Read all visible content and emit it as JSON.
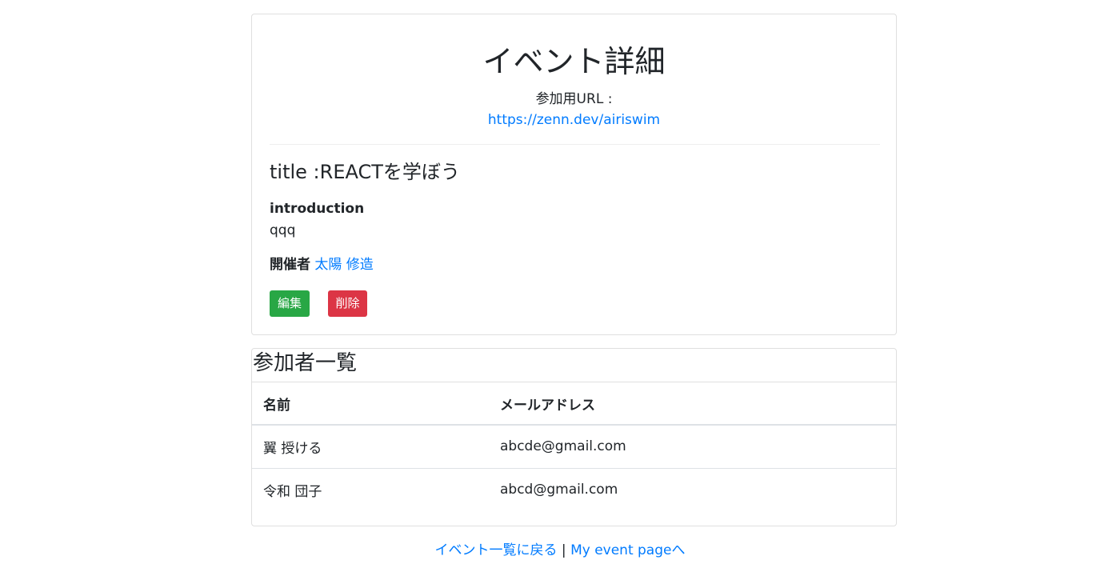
{
  "event": {
    "heading": "イベント詳細",
    "url_label": "参加用URL :",
    "url": "https://zenn.dev/airiswim",
    "title_text": "title :REACTを学ぼう",
    "introduction_label": "introduction",
    "introduction": "qqq",
    "organizer_label": "開催者",
    "organizer_name": "太陽 修造",
    "edit_label": "編集",
    "delete_label": "削除"
  },
  "participants": {
    "heading": "参加者一覧",
    "columns": [
      "名前",
      "メールアドレス"
    ],
    "rows": [
      {
        "name": "翼 授ける",
        "email": "abcde@gmail.com"
      },
      {
        "name": "令和 団子",
        "email": "abcd@gmail.com"
      }
    ]
  },
  "footer": {
    "back_link": "イベント一覧に戻る",
    "separator": "|",
    "my_page_link": "My event pageへ"
  },
  "colors": {
    "link": "#007bff",
    "edit_button": "#28a745",
    "delete_button": "#dc3545"
  }
}
